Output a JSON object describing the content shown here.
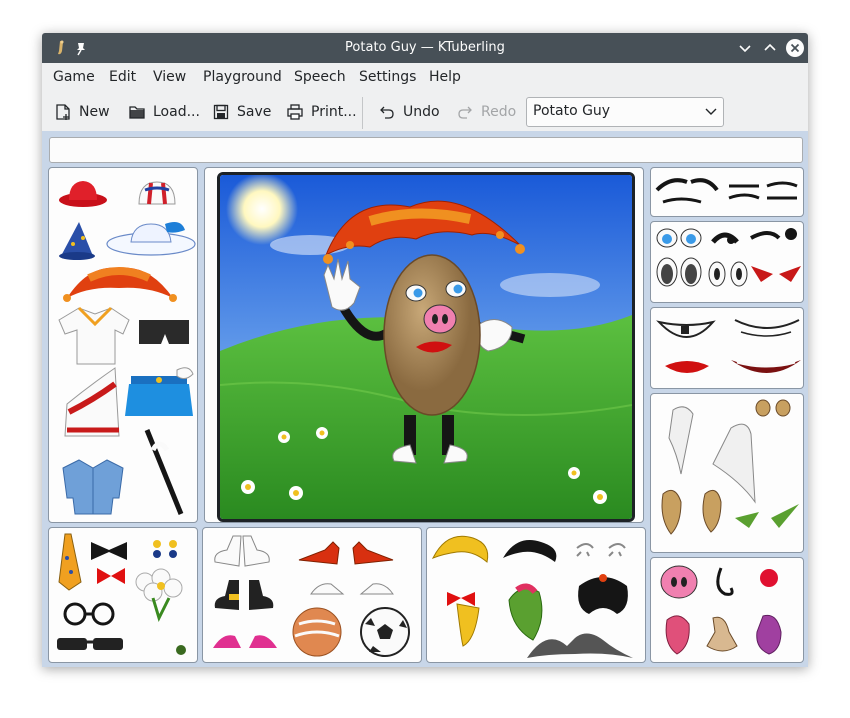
{
  "window": {
    "title": "Potato Guy — KTuberling",
    "buttons": [
      "minimize",
      "maximize",
      "close"
    ]
  },
  "menu": [
    "Game",
    "Edit",
    "View",
    "Playground",
    "Speech",
    "Settings",
    "Help"
  ],
  "toolbar": {
    "new_label": "New",
    "load_label": "Load...",
    "save_label": "Save",
    "print_label": "Print...",
    "undo_label": "Undo",
    "redo_label": "Redo",
    "playground_select": "Potato Guy"
  },
  "colors": {
    "titlebar": "#475057",
    "sky": "#1f6fe0",
    "grass": "#3aa02a",
    "panel_bg": "#c8d6e8"
  },
  "palettes": {
    "left": [
      "red-hat",
      "cap",
      "wizard-hat",
      "ladies-hat",
      "jester-hat",
      "shirt",
      "shorts",
      "toga",
      "skirt",
      "denim-jacket",
      "cane"
    ],
    "bottom_left": [
      "tie",
      "bow-tie",
      "earrings",
      "red-bow",
      "flowers",
      "glasses",
      "sunglasses",
      "bug"
    ],
    "bottom_mid": [
      "white-boots",
      "elf-shoes",
      "black-shoes",
      "sneakers",
      "pink-shoes",
      "ball",
      "soccer-ball"
    ],
    "bottom_right": [
      "blonde-hair",
      "black-hair",
      "spider",
      "red-bow-hair",
      "green-hair",
      "black-wig",
      "mustache"
    ],
    "right": [
      "eyebrows",
      "eyes",
      "mouths",
      "ears",
      "noses"
    ]
  }
}
